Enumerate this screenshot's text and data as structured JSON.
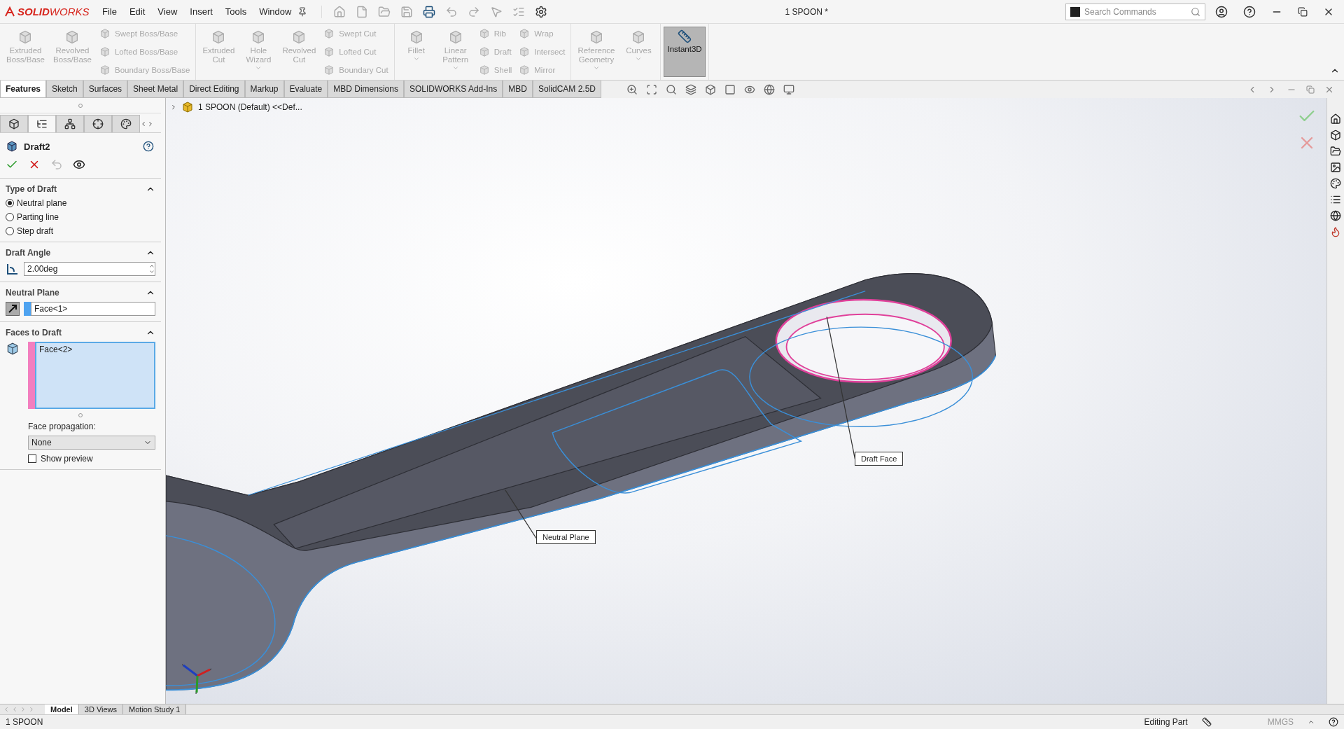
{
  "app": {
    "logo": "**SOLID**WORKS",
    "menu": [
      "File",
      "Edit",
      "View",
      "Insert",
      "Tools",
      "Window"
    ],
    "title": "1 SPOON *",
    "search": {
      "placeholder": "Search Commands"
    }
  },
  "ribbon": [
    {
      "columns": [
        {
          "kind": "large",
          "label": "Extruded\nBoss/Base",
          "disabled": true,
          "dropdown": false,
          "selected": false
        },
        {
          "kind": "large",
          "label": "Revolved\nBoss/Base",
          "disabled": true,
          "dropdown": false,
          "selected": false
        },
        {
          "kind": "stack",
          "items": [
            {
              "label": "Swept Boss/Base",
              "disabled": true
            },
            {
              "label": "Lofted Boss/Base",
              "disabled": true
            },
            {
              "label": "Boundary Boss/Base",
              "disabled": true
            }
          ]
        }
      ]
    },
    {
      "columns": [
        {
          "kind": "large",
          "label": "Extruded\nCut",
          "disabled": true,
          "dropdown": false,
          "selected": false
        },
        {
          "kind": "large",
          "label": "Hole\nWizard",
          "disabled": true,
          "dropdown": true,
          "selected": false
        },
        {
          "kind": "large",
          "label": "Revolved\nCut",
          "disabled": true,
          "dropdown": false,
          "selected": false
        },
        {
          "kind": "stack",
          "items": [
            {
              "label": "Swept Cut",
              "disabled": true
            },
            {
              "label": "Lofted Cut",
              "disabled": true
            },
            {
              "label": "Boundary Cut",
              "disabled": true
            }
          ]
        }
      ]
    },
    {
      "columns": [
        {
          "kind": "large",
          "label": "Fillet",
          "disabled": true,
          "dropdown": true,
          "selected": false
        },
        {
          "kind": "large",
          "label": "Linear\nPattern",
          "disabled": true,
          "dropdown": true,
          "selected": false
        },
        {
          "kind": "stack",
          "items": [
            {
              "label": "Rib",
              "disabled": true
            },
            {
              "label": "Draft",
              "disabled": true
            },
            {
              "label": "Shell",
              "disabled": true
            }
          ]
        },
        {
          "kind": "stack",
          "items": [
            {
              "label": "Wrap",
              "disabled": true
            },
            {
              "label": "Intersect",
              "disabled": true
            },
            {
              "label": "Mirror",
              "disabled": true
            }
          ]
        }
      ]
    },
    {
      "columns": [
        {
          "kind": "large",
          "label": "Reference\nGeometry",
          "disabled": true,
          "dropdown": true,
          "selected": false
        },
        {
          "kind": "large",
          "label": "Curves",
          "disabled": true,
          "dropdown": true,
          "selected": false
        }
      ]
    },
    {
      "columns": [
        {
          "kind": "large",
          "label": "Instant3D",
          "disabled": false,
          "dropdown": false,
          "selected": true
        }
      ]
    }
  ],
  "tabs": [
    {
      "label": "Features",
      "selected": true
    },
    {
      "label": "Sketch",
      "selected": false
    },
    {
      "label": "Surfaces",
      "selected": false
    },
    {
      "label": "Sheet Metal",
      "selected": false
    },
    {
      "label": "Direct Editing",
      "selected": false
    },
    {
      "label": "Markup",
      "selected": false
    },
    {
      "label": "Evaluate",
      "selected": false
    },
    {
      "label": "MBD Dimensions",
      "selected": false
    },
    {
      "label": "SOLIDWORKS Add-Ins",
      "selected": false
    },
    {
      "label": "MBD",
      "selected": false
    },
    {
      "label": "SolidCAM 2.5D",
      "selected": false
    }
  ],
  "manager_tabs": [
    {
      "selected": false
    },
    {
      "selected": true
    },
    {
      "selected": false
    },
    {
      "selected": false
    },
    {
      "selected": false
    }
  ],
  "property_manager": {
    "title": "Draft2",
    "sections": [
      {
        "kind": "radios",
        "title": "Type of Draft",
        "expanded": true,
        "options": [
          {
            "label": "Neutral plane",
            "selected": true
          },
          {
            "label": "Parting line",
            "selected": false
          },
          {
            "label": "Step draft",
            "selected": false
          }
        ]
      },
      {
        "kind": "angle",
        "title": "Draft Angle",
        "expanded": true,
        "value": "2.00deg"
      },
      {
        "kind": "neutral",
        "title": "Neutral Plane",
        "expanded": true,
        "value": "Face<1>"
      },
      {
        "kind": "faces",
        "title": "Faces to Draft",
        "expanded": true,
        "value": "Face<2>",
        "propagation_label": "Face propagation:",
        "propagation": "None",
        "preview_label": "Show preview",
        "preview_checked": false
      }
    ]
  },
  "tree": {
    "root": "1 SPOON (Default) <<Def..."
  },
  "callouts": [
    {
      "label": "Neutral Plane"
    },
    {
      "label": "Draft Face"
    }
  ],
  "bottom_tabs": [
    {
      "label": "Model",
      "selected": true
    },
    {
      "label": "3D Views",
      "selected": false
    },
    {
      "label": "Motion Study 1",
      "selected": false
    }
  ],
  "status_bar": {
    "document": "1 SPOON",
    "mode": "Editing Part",
    "units": "MMGS"
  }
}
